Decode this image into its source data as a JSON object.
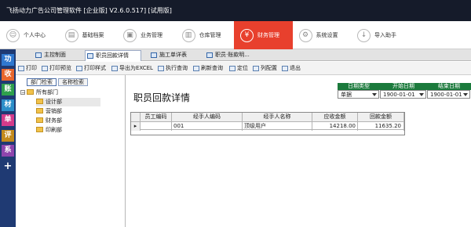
{
  "app": {
    "title": "飞扬动力广告公司管理软件 [企业版]    V2.6.0.517] [试用版]"
  },
  "modules": [
    {
      "label": "个人中心",
      "icon": "person-icon"
    },
    {
      "label": "基础档案",
      "icon": "folder-icon"
    },
    {
      "label": "业务管理",
      "icon": "briefcase-icon"
    },
    {
      "label": "仓库管理",
      "icon": "warehouse-icon"
    },
    {
      "label": "财务管理",
      "icon": "yuan-icon"
    },
    {
      "label": "系统设置",
      "icon": "gear-icon"
    },
    {
      "label": "导入助手",
      "icon": "import-icon"
    }
  ],
  "active_module": "财务管理",
  "left_nav": [
    "功",
    "收",
    "账",
    "材",
    "单",
    "评",
    "系",
    "+"
  ],
  "tabs": [
    {
      "label": "主控制面"
    },
    {
      "label": "职员回款详情"
    },
    {
      "label": "施工单详表"
    },
    {
      "label": "职员·账款明..."
    }
  ],
  "toolbar": [
    {
      "label": "打印",
      "icon": "print-icon"
    },
    {
      "label": "打印预览",
      "icon": "preview-icon"
    },
    {
      "label": "打印样式",
      "icon": "print-style-icon"
    },
    {
      "label": "导出为EXCEL",
      "icon": "excel-icon"
    },
    {
      "label": "执行查询",
      "icon": "search-icon"
    },
    {
      "label": "刷新查询",
      "icon": "refresh-icon"
    },
    {
      "label": "定位",
      "icon": "locate-icon"
    },
    {
      "label": "列配置",
      "icon": "columns-icon"
    },
    {
      "label": "退出",
      "icon": "exit-icon"
    }
  ],
  "tree_tabs": [
    "部门检索",
    "名称检索"
  ],
  "tree": {
    "root": "所有部门",
    "children": [
      "设计部",
      "营销部",
      "财务部",
      "印刷部"
    ],
    "selected": "设计部"
  },
  "content": {
    "heading": "职员回款详情",
    "filters": {
      "type_label": "日期类型",
      "type_value": "单据",
      "start_label": "开始日期",
      "start_value": "1900-01-01",
      "end_label": "结束日期",
      "end_value": "1900-01-01"
    }
  },
  "grid": {
    "columns": [
      "",
      "员工编码",
      "经手人编码",
      "经手人名称",
      "应收金额",
      "回款金额"
    ],
    "rows": [
      {
        "indicator": "▸",
        "员工编码": "",
        "经手人编码": "001",
        "经手人名称": "顶级用户",
        "应收金额": "14218.00",
        "回款金额": "11635.20"
      }
    ]
  }
}
